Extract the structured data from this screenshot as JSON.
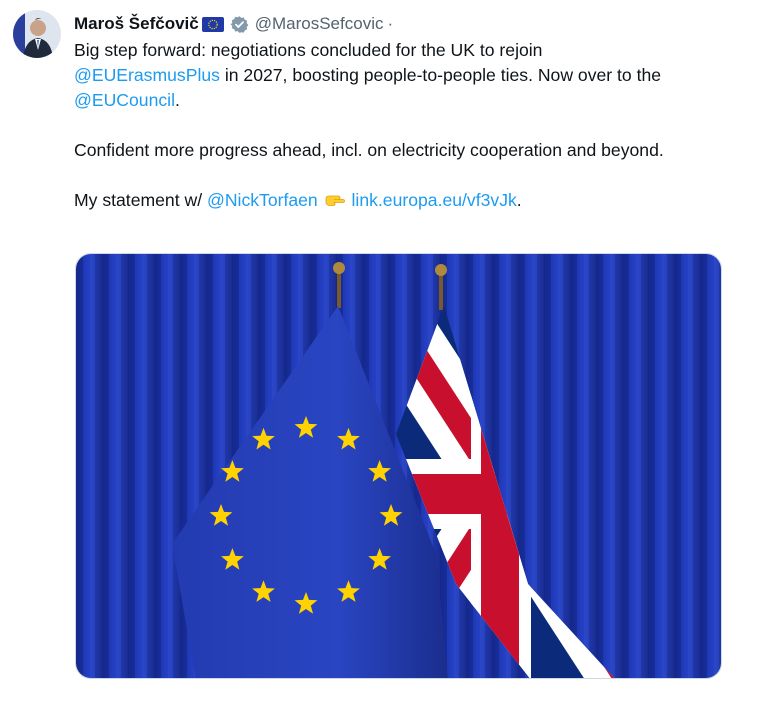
{
  "author": {
    "display_name": "Maroš Šefčovič",
    "handle": "@MarosSefcovic",
    "separator": "·"
  },
  "tweet": {
    "line1_text": "Big step forward: negotiations concluded for the UK to rejoin",
    "mention_erasmus": "@EUErasmusPlus",
    "line2_text": " in 2027, boosting people-to-people ties. Now over to the",
    "mention_council": "@EUCouncil",
    "line3_suffix": ".",
    "para2": "Confident more progress ahead, incl. on electricity cooperation and beyond.",
    "para3_prefix": "My statement w/ ",
    "mention_torfaen": "@NickTorfaen",
    "link": "link.europa.eu/vf3vJk",
    "para3_suffix": "."
  },
  "icons": {
    "verified": "verified-badge-icon",
    "eu_flag_emoji": "eu-flag-emoji-icon",
    "pointing_hand": "pointing-right-hand-icon"
  },
  "colors": {
    "link": "#1d9bf0",
    "text": "#0f1419",
    "muted": "#536471",
    "eu_blue": "#1f3aa8",
    "uk_red": "#c8102e",
    "curtain": "#1a2f9e"
  }
}
